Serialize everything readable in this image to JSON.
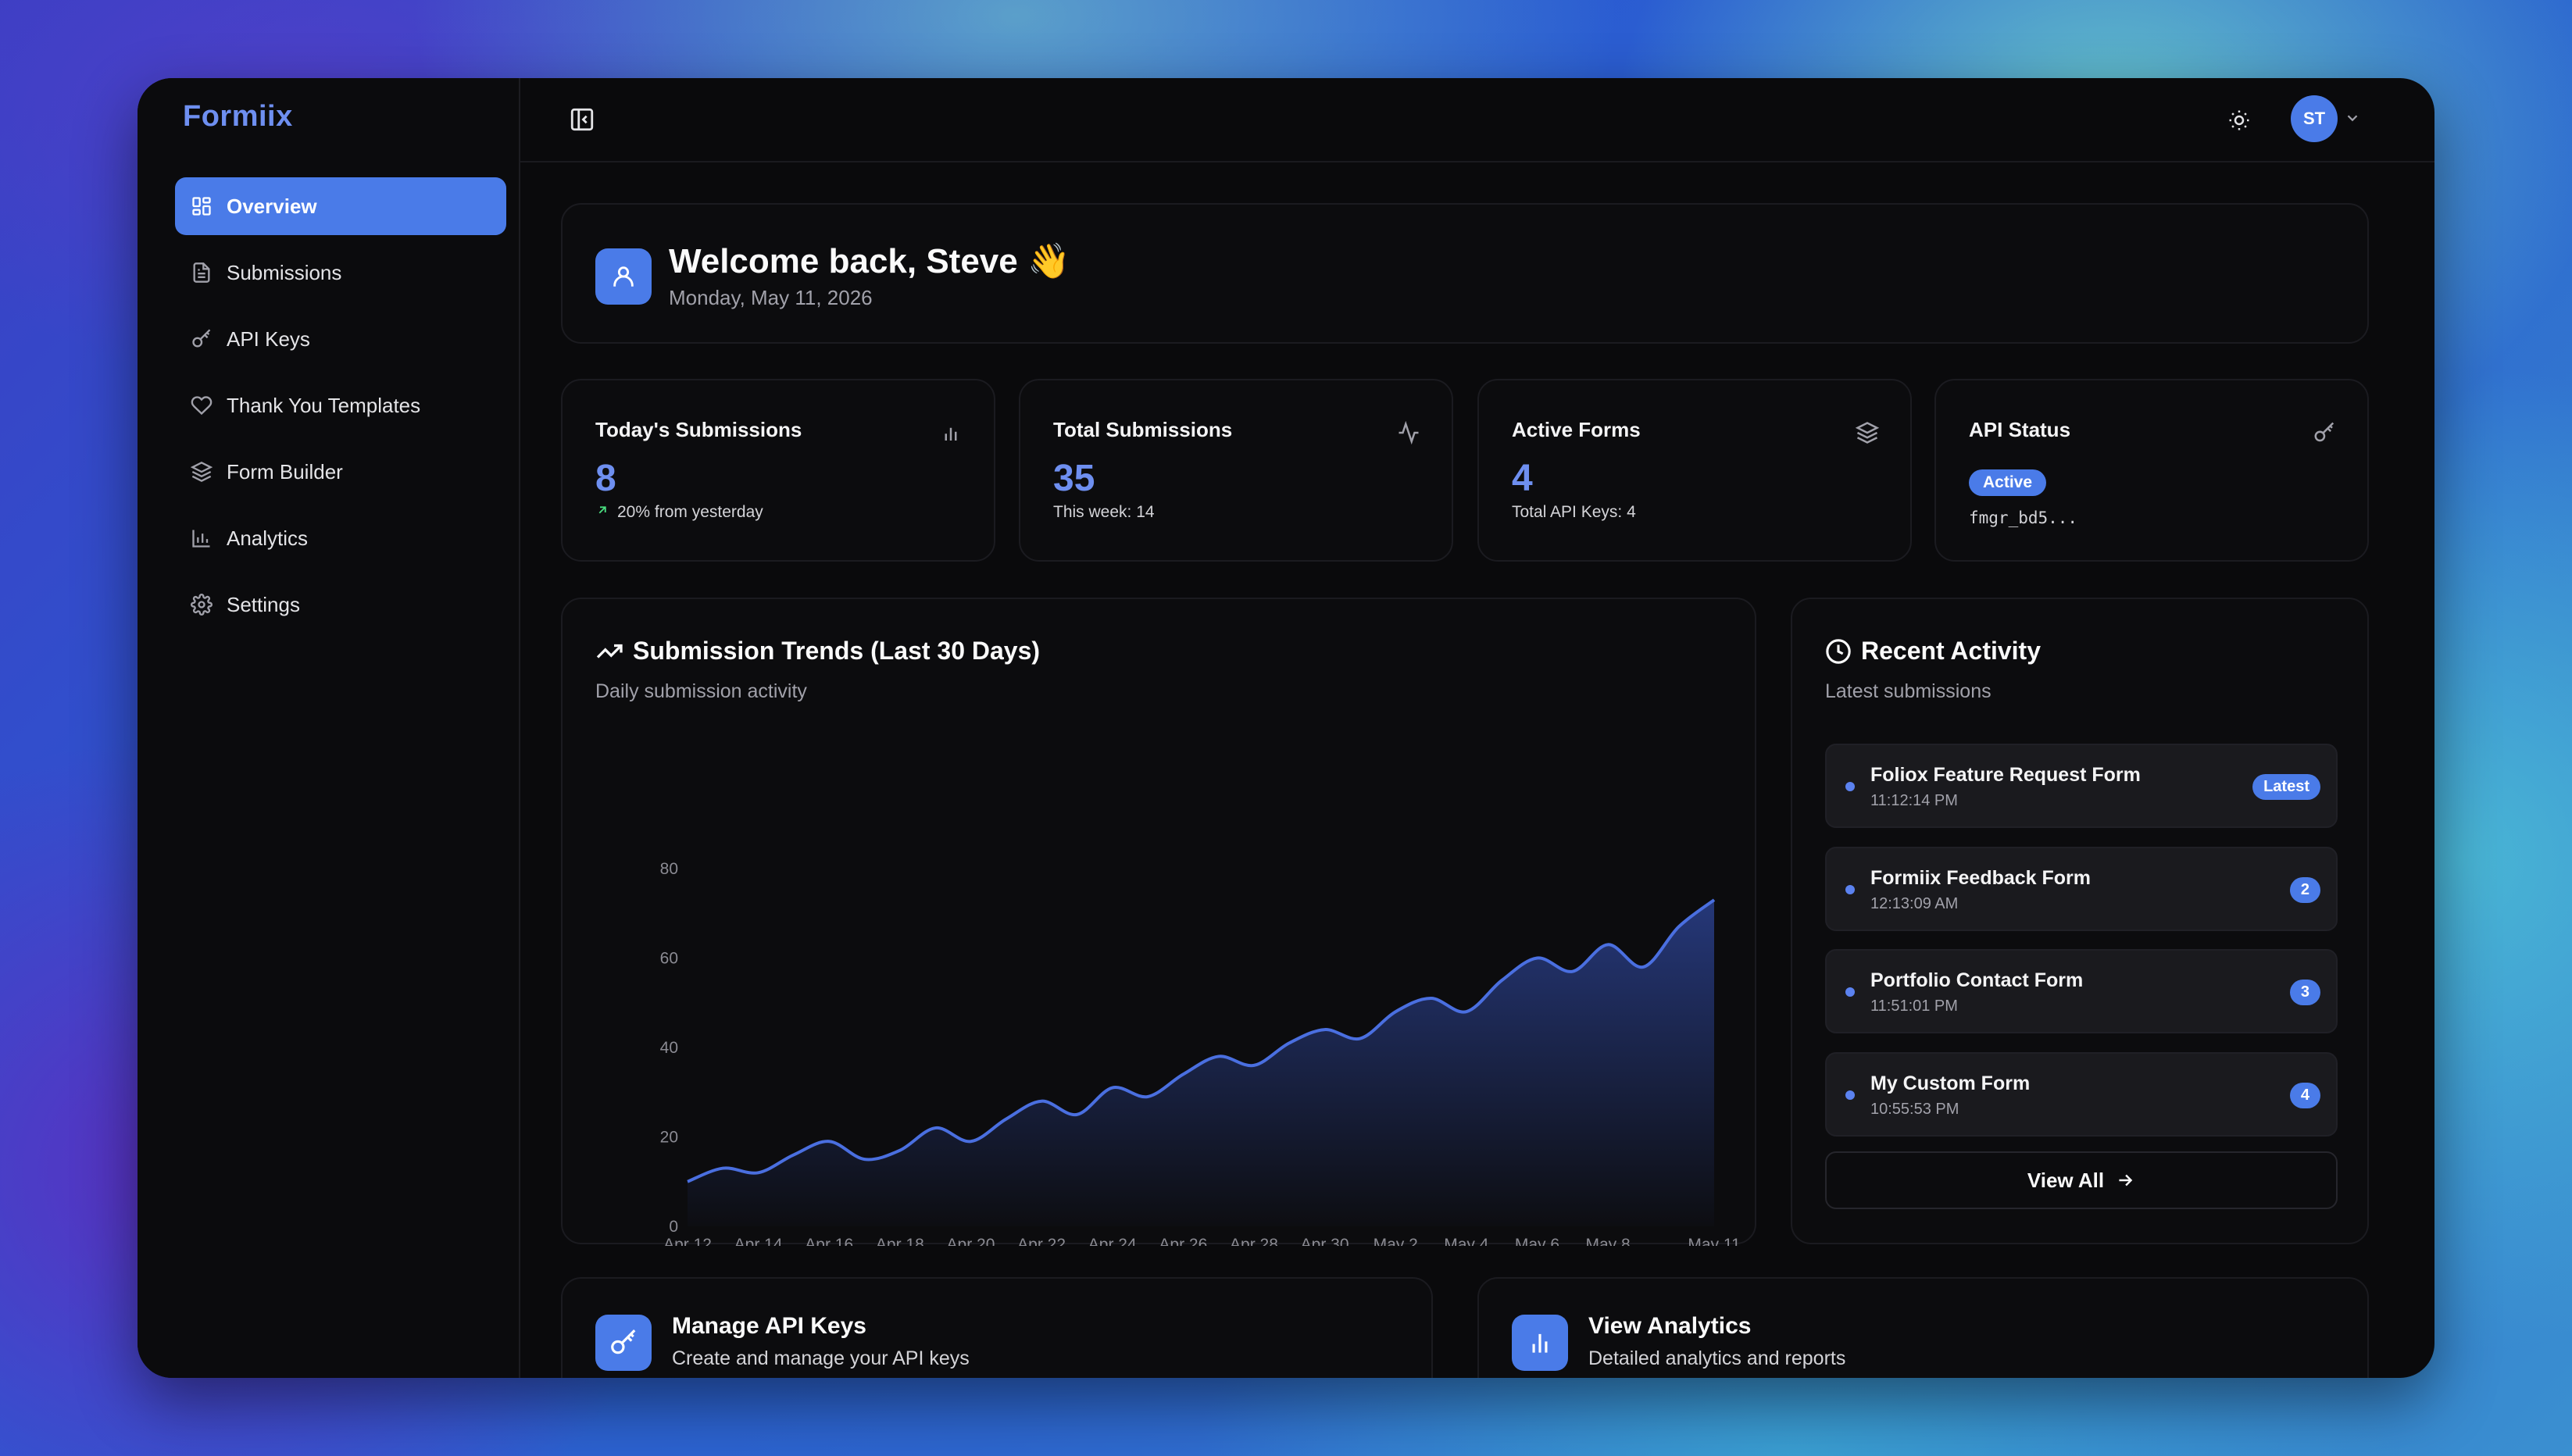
{
  "app": {
    "brand": "Formiix"
  },
  "sidebar": {
    "items": [
      {
        "label": "Overview",
        "icon": "grid-icon",
        "active": true
      },
      {
        "label": "Submissions",
        "icon": "file-text-icon"
      },
      {
        "label": "API Keys",
        "icon": "key-icon"
      },
      {
        "label": "Thank You Templates",
        "icon": "heart-icon"
      },
      {
        "label": "Form Builder",
        "icon": "layers-icon"
      },
      {
        "label": "Analytics",
        "icon": "bar-chart-icon"
      },
      {
        "label": "Settings",
        "icon": "gear-icon"
      }
    ]
  },
  "header": {
    "avatar_initials": "ST"
  },
  "welcome": {
    "title": "Welcome back, Steve 👋",
    "date": "Monday, May 11, 2026"
  },
  "stats": {
    "today": {
      "label": "Today's Submissions",
      "value": "8",
      "sub": "20% from yesterday"
    },
    "total": {
      "label": "Total Submissions",
      "value": "35",
      "sub": "This week: 14"
    },
    "forms": {
      "label": "Active Forms",
      "value": "4",
      "sub": "Total API Keys: 4"
    },
    "api": {
      "label": "API Status",
      "badge": "Active",
      "key": "fmgr_bd5..."
    }
  },
  "chart": {
    "title": "Submission Trends (Last 30 Days)",
    "subtitle": "Daily submission activity"
  },
  "chart_data": {
    "type": "area",
    "title": "Submission Trends (Last 30 Days)",
    "xlabel": "",
    "ylabel": "",
    "x_ticks": [
      "Apr 12",
      "Apr 14",
      "Apr 16",
      "Apr 18",
      "Apr 20",
      "Apr 22",
      "Apr 24",
      "Apr 26",
      "Apr 28",
      "Apr 30",
      "May 2",
      "May 4",
      "May 6",
      "May 8",
      "May 11"
    ],
    "y_ticks": [
      "80",
      "60",
      "40",
      "20",
      "0"
    ],
    "ylim": [
      0,
      80
    ],
    "grid": false,
    "color": "#4a6fe0",
    "series": [
      {
        "values": [
          10,
          13,
          12,
          16,
          19,
          15,
          17,
          22,
          19,
          24,
          28,
          25,
          31,
          29,
          34,
          38,
          36,
          41,
          44,
          42,
          48,
          51,
          48,
          55,
          60,
          57,
          63,
          58,
          67,
          73
        ]
      }
    ]
  },
  "activity": {
    "title": "Recent Activity",
    "subtitle": "Latest submissions",
    "items": [
      {
        "name": "Foliox Feature Request Form",
        "time": "11:12:14 PM",
        "badge": "Latest"
      },
      {
        "name": "Formiix Feedback Form",
        "time": "12:13:09 AM",
        "badge": "2"
      },
      {
        "name": "Portfolio Contact Form",
        "time": "11:51:01 PM",
        "badge": "3"
      },
      {
        "name": "My Custom Form",
        "time": "10:55:53 PM",
        "badge": "4"
      }
    ],
    "view_all": "View All"
  },
  "quick": {
    "api": {
      "title": "Manage API Keys",
      "sub": "Create and manage your API keys"
    },
    "analytics": {
      "title": "View Analytics",
      "sub": "Detailed analytics and reports"
    }
  },
  "colors": {
    "accent": "#4a7be8",
    "brand": "#6e8ff0",
    "background": "#0a0a0c"
  }
}
